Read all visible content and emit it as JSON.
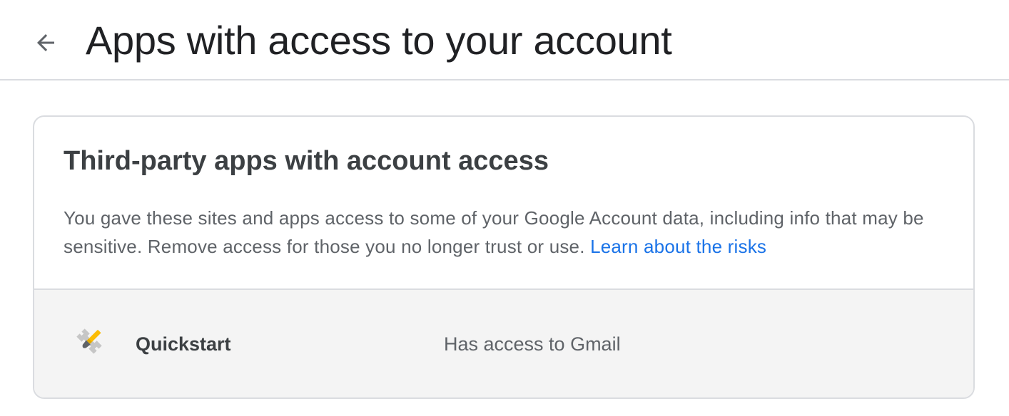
{
  "header": {
    "back_icon": "arrow-back-icon",
    "title": "Apps with access to your account"
  },
  "card": {
    "title": "Third-party apps with account access",
    "description": "You gave these sites and apps access to some of your Google Account data, including info that may be sensitive. Remove access for those you no longer trust or use.",
    "link_text": "Learn about the risks",
    "link_color": "#1a73e8"
  },
  "apps": [
    {
      "icon": "wrench-brush-icon",
      "name": "Quickstart",
      "access": "Has access to Gmail"
    }
  ]
}
